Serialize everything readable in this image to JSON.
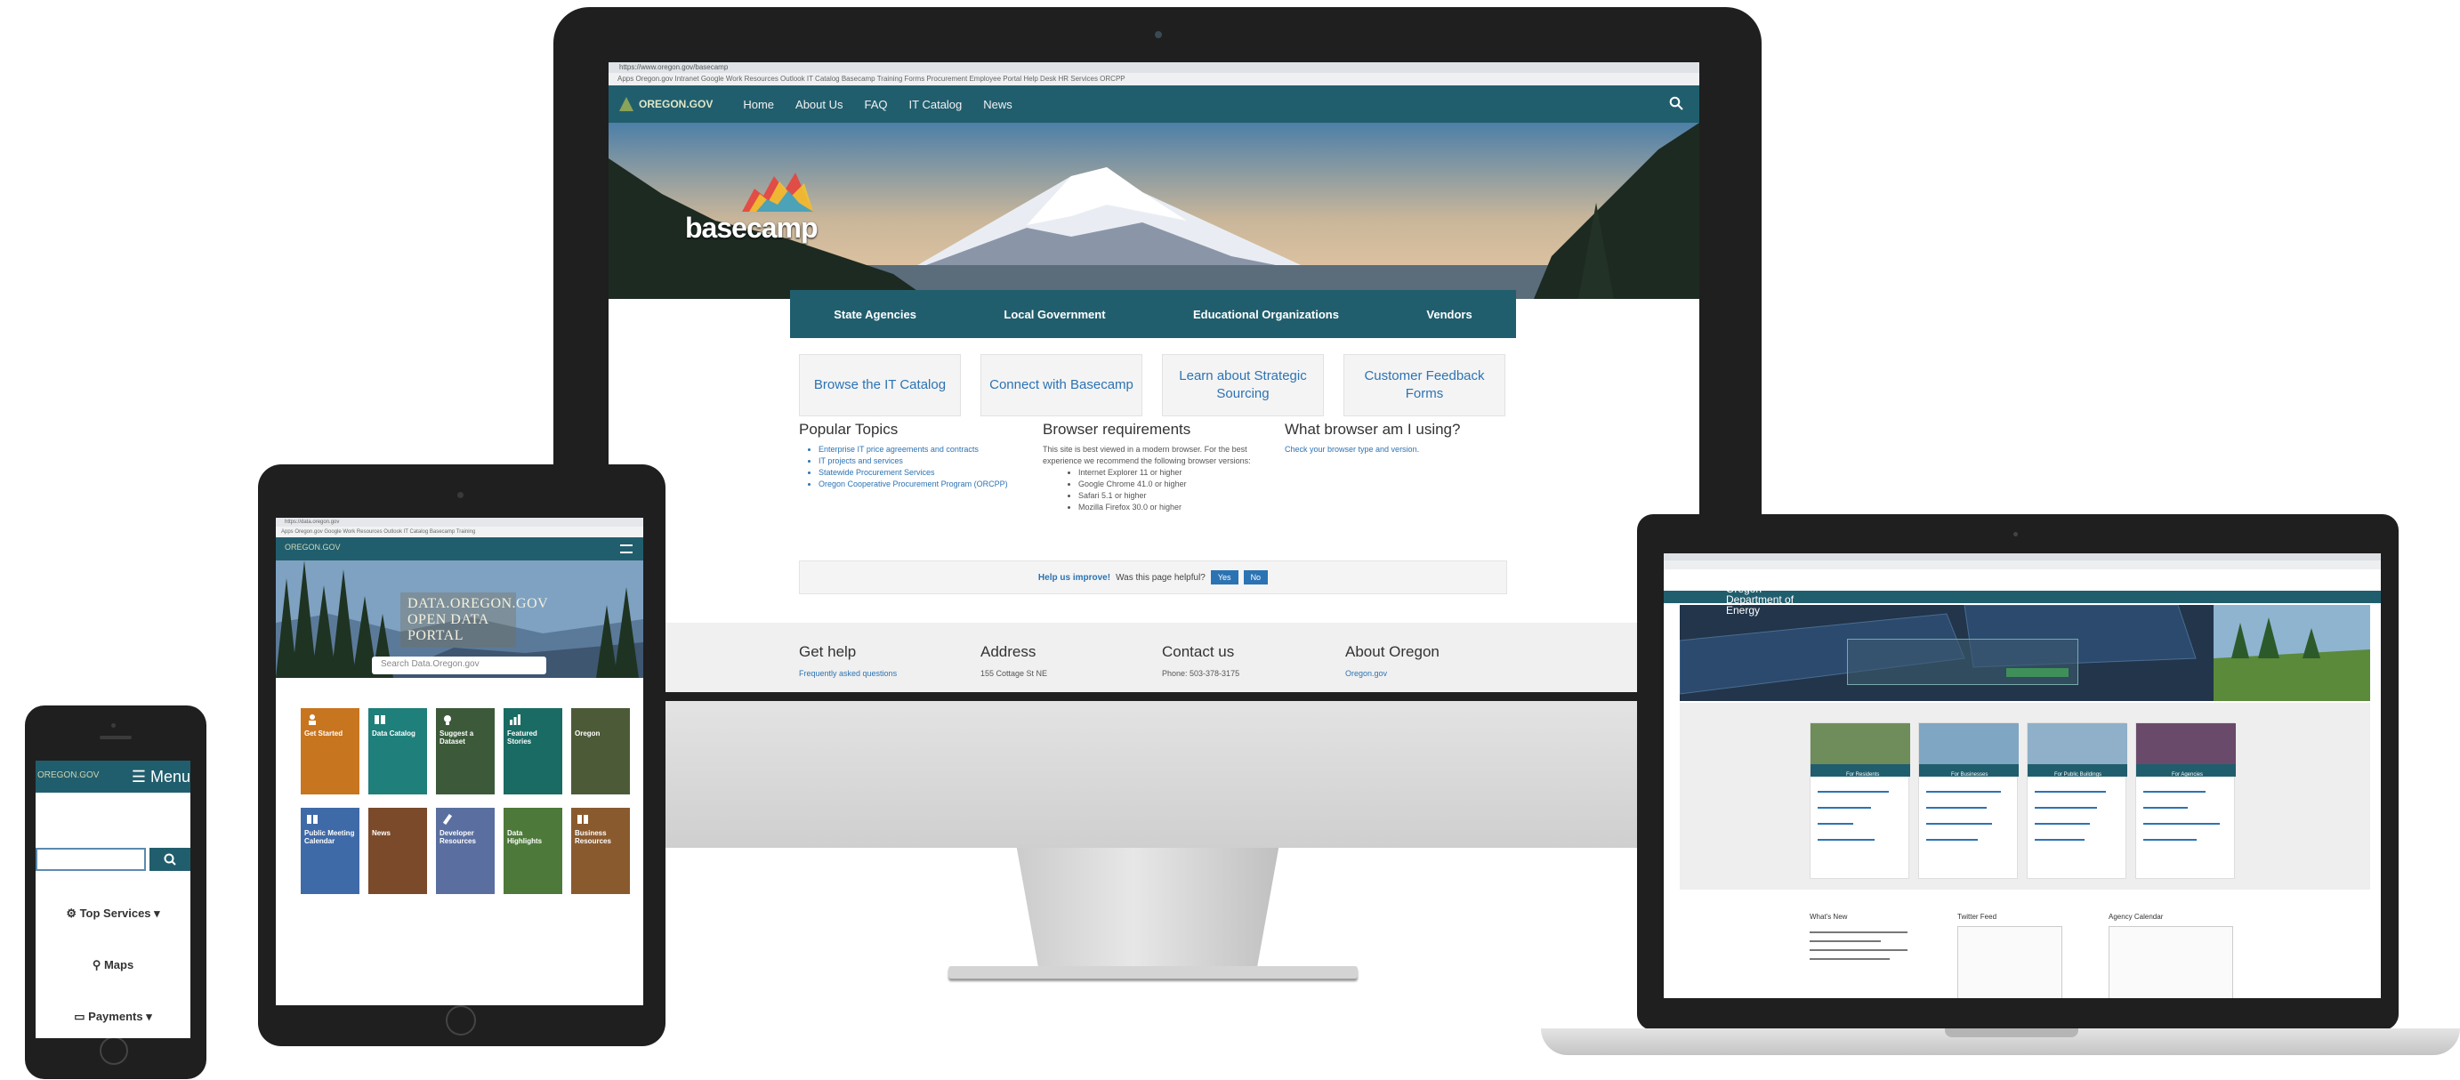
{
  "desktop": {
    "browser_tab": "https://www.oregon.gov/basecamp",
    "bookmarks": "Apps  Oregon.gov Intranet  Google  Work Resources  Outlook  IT Catalog  Basecamp  Training  Forms  Procurement  Employee Portal  Help Desk  HR Services  ORCPP",
    "nav_logo": "OREGON.GOV",
    "nav_items": [
      "Home",
      "About Us",
      "FAQ",
      "IT Catalog",
      "News"
    ],
    "brand": "basecamp",
    "tabs": [
      "State Agencies",
      "Local Government",
      "Educational Organizations",
      "Vendors"
    ],
    "cards": [
      "Browse the IT Catalog",
      "Connect with Basecamp",
      "Learn about Strategic Sourcing",
      "Customer Feedback Forms"
    ],
    "popular": {
      "heading": "Popular Topics",
      "items": [
        "Enterprise IT price agreements and contracts",
        "IT projects and services",
        "Statewide Procurement Services",
        "Oregon Cooperative Procurement Program (ORCPP)"
      ]
    },
    "browser": {
      "heading": "Browser requirements",
      "text": "This site is best viewed in a modern browser. For the best experience we recommend the following browser versions:",
      "items": [
        "Internet Explorer 11 or higher",
        "Google Chrome 41.0 or higher",
        "Safari 5.1 or higher",
        "Mozilla Firefox 30.0 or higher"
      ]
    },
    "which": {
      "heading": "What browser am I using?",
      "text": "Check your browser type and version."
    },
    "feedback": {
      "lead": "Help us improve!",
      "question": "Was this page helpful?",
      "yes": "Yes",
      "no": "No"
    },
    "footer": [
      {
        "heading": "Get help",
        "sub": "Frequently asked questions"
      },
      {
        "heading": "Address",
        "sub": "155 Cottage St NE"
      },
      {
        "heading": "Contact us",
        "sub": "Phone: 503-378-3175"
      },
      {
        "heading": "About Oregon",
        "sub": "Oregon.gov"
      }
    ]
  },
  "tablet": {
    "browser_tab": "https://data.oregon.gov",
    "bookmarks": "Apps  Oregon.gov  Google  Work Resources  Outlook  IT Catalog  Basecamp  Training",
    "nav_logo": "OREGON.GOV",
    "portal_lines": [
      "DATA.OREGON.GOV",
      "OPEN DATA",
      "PORTAL"
    ],
    "search_placeholder": "Search Data.Oregon.gov",
    "tiles": [
      {
        "label": "Get Started",
        "color": "#c8751f"
      },
      {
        "label": "Data Catalog",
        "color": "#1f7f7a"
      },
      {
        "label": "Suggest a Dataset",
        "color": "#3c5a3a"
      },
      {
        "label": "Featured Stories",
        "color": "#1a6b63"
      },
      {
        "label": "Oregon",
        "color": "#4d5a38"
      },
      {
        "label": "Public Meeting Calendar",
        "color": "#3f6aa8"
      },
      {
        "label": "News",
        "color": "#7a4a2a"
      },
      {
        "label": "Developer Resources",
        "color": "#5a6fa0"
      },
      {
        "label": "Data Highlights",
        "color": "#4d7a3a"
      },
      {
        "label": "Business Resources",
        "color": "#8a5a2f"
      }
    ]
  },
  "phone": {
    "nav_logo": "OREGON.GOV",
    "menu": "☰ Menu",
    "links": [
      "⚙ Top Services ▾",
      "⚲ Maps",
      "▭ Payments ▾"
    ]
  },
  "laptop": {
    "org_lines": [
      "Oregon",
      "Department of",
      "Energy"
    ],
    "cards": [
      "For Residents",
      "For Businesses",
      "For Public Buildings",
      "For Agencies"
    ],
    "sections": [
      "What's New",
      "Twitter Feed",
      "Agency Calendar"
    ]
  },
  "colors": {
    "nav_teal": "#215e6d",
    "link_blue": "#2c73b3",
    "bezel": "#1f1f1f"
  }
}
